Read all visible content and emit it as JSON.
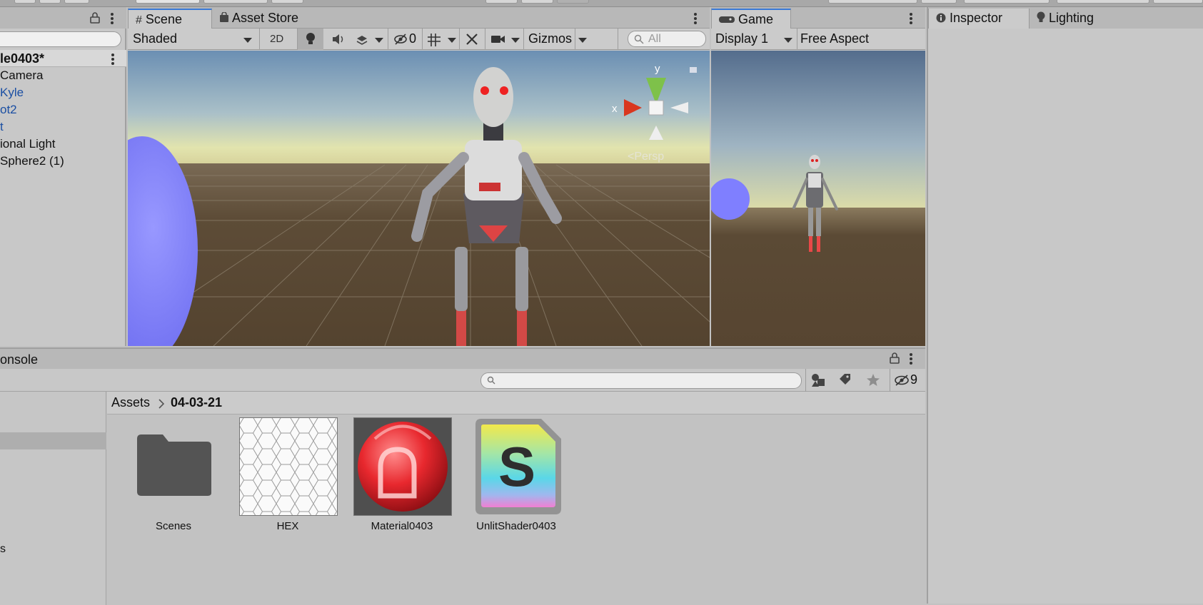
{
  "hierarchy": {
    "scene_name": "le0403*",
    "items": [
      {
        "label": "Camera",
        "prefab": false
      },
      {
        "label": "Kyle",
        "prefab": true
      },
      {
        "label": "ot2",
        "prefab": true
      },
      {
        "label": "t",
        "prefab": true
      },
      {
        "label": "ional Light",
        "prefab": false
      },
      {
        "label": "Sphere2 (1)",
        "prefab": false
      }
    ]
  },
  "scene_view": {
    "tabs": [
      {
        "label": "Scene",
        "icon": "grid-icon",
        "active": true
      },
      {
        "label": "Asset Store",
        "icon": "shopping-bag-icon",
        "active": false
      }
    ],
    "toolbar": {
      "draw_mode": "Shaded",
      "toggle_2d": "2D",
      "hidden_count": "0",
      "gizmos_label": "Gizmos",
      "search_placeholder": "All"
    },
    "gizmo": {
      "y_label": "y",
      "x_label": "x",
      "projection_label": "<Persp"
    }
  },
  "game_view": {
    "tab": {
      "label": "Game",
      "icon": "gamepad-icon"
    },
    "display": "Display 1",
    "aspect": "Free Aspect"
  },
  "inspector": {
    "tabs": [
      {
        "label": "Inspector",
        "icon": "info-icon",
        "active": true
      },
      {
        "label": "Lighting",
        "icon": "lightbulb-icon",
        "active": false
      }
    ]
  },
  "project": {
    "tab_label": "onsole",
    "hidden_count": "9",
    "breadcrumb": {
      "root": "Assets",
      "current": "04-03-21"
    },
    "tree_partial_label": "s",
    "assets": [
      {
        "name": "Scenes",
        "type": "folder"
      },
      {
        "name": "HEX",
        "type": "texture"
      },
      {
        "name": "Material0403",
        "type": "material"
      },
      {
        "name": "UnlitShader0403",
        "type": "shader",
        "glyph": "S"
      }
    ]
  },
  "colors": {
    "accent_tab": "#3a79d6",
    "prefab_text": "#1b4fa3",
    "sphere": "#7d7dff",
    "ground": "#5a4a34",
    "material_red": "#e8282e"
  }
}
